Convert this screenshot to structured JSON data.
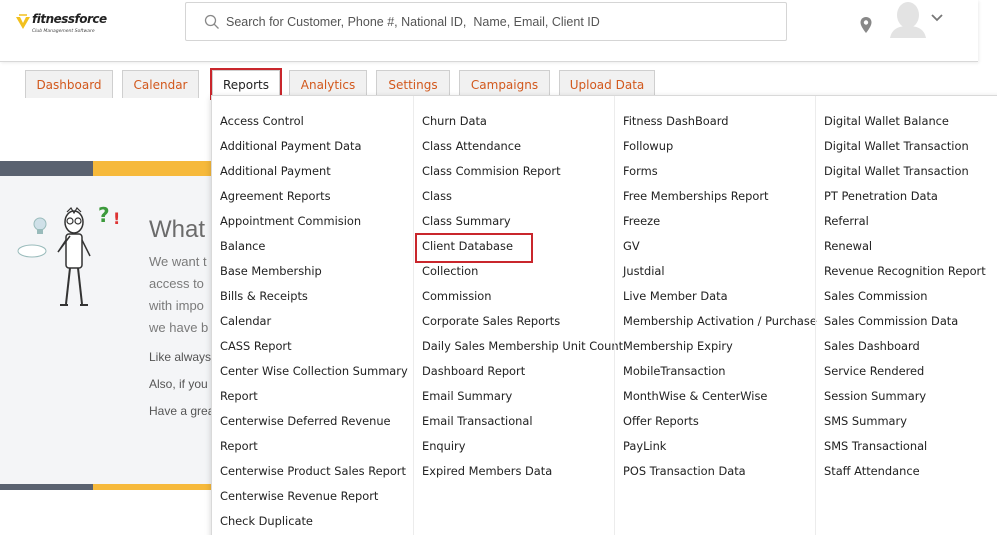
{
  "brand": {
    "name_part1": "fitness",
    "name_part2": "force",
    "tagline": "Club Management Software",
    "accent_color": "#f6b93b",
    "mark_color": "#f2c01e"
  },
  "search": {
    "placeholder": "Search for Customer, Phone #, National ID,  Name, Email, Client ID",
    "value": "",
    "icon": "search-icon"
  },
  "header_icons": {
    "location": "location-pin-icon",
    "avatar": "user-avatar-icon",
    "menu": "chevron-down-icon"
  },
  "tabs": [
    {
      "label": "Dashboard",
      "active": false
    },
    {
      "label": "Calendar",
      "active": false
    },
    {
      "label": "Reports",
      "active": true
    },
    {
      "label": "Analytics",
      "active": false
    },
    {
      "label": "Settings",
      "active": false
    },
    {
      "label": "Campaigns",
      "active": false
    },
    {
      "label": "Upload Data",
      "active": false
    }
  ],
  "background": {
    "heading": "What",
    "lines": [
      "We want t",
      "access to",
      "with impo",
      "we have b"
    ],
    "small_lines": [
      "Like always",
      "Also, if you",
      "Have a grea"
    ]
  },
  "reports_menu": {
    "highlighted": "Client Database",
    "columns": [
      [
        "Access Control",
        "Additional Payment Data",
        "Additional Payment",
        "Agreement Reports",
        "Appointment Commision",
        "Balance",
        "Base Membership",
        "Bills & Receipts",
        "Calendar",
        "CASS Report",
        "Center Wise Collection Summary",
        "Report",
        "Centerwise Deferred Revenue",
        "Report",
        "Centerwise Product Sales Report",
        "Centerwise Revenue Report",
        "Check Duplicate"
      ],
      [
        "Churn Data",
        "Class Attendance",
        "Class Commision Report",
        "Class",
        "Class Summary",
        "Client Database",
        "Collection",
        "Commission",
        "Corporate Sales Reports",
        "Daily Sales Membership Unit Count",
        "Dashboard Report",
        "Email Summary",
        "Email Transactional",
        "Enquiry",
        "Expired Members Data"
      ],
      [
        "Fitness DashBoard",
        "Followup",
        "Forms",
        "Free Memberships Report",
        "Freeze",
        "GV",
        "Justdial",
        "Live Member Data",
        "Membership Activation / Purchase",
        "Membership Expiry",
        "MobileTransaction",
        "MonthWise & CenterWise",
        "Offer Reports",
        "PayLink",
        "POS Transaction Data"
      ],
      [
        "Digital Wallet Balance",
        "Digital Wallet Transaction",
        "Digital Wallet Transaction",
        "PT Penetration Data",
        "Referral",
        "Renewal",
        "Revenue Recognition Report",
        "Sales Commission",
        "Sales Commission Data",
        "Sales Dashboard",
        "Service Rendered",
        "Session Summary",
        "SMS Summary",
        "SMS Transactional",
        "Staff Attendance"
      ]
    ]
  }
}
